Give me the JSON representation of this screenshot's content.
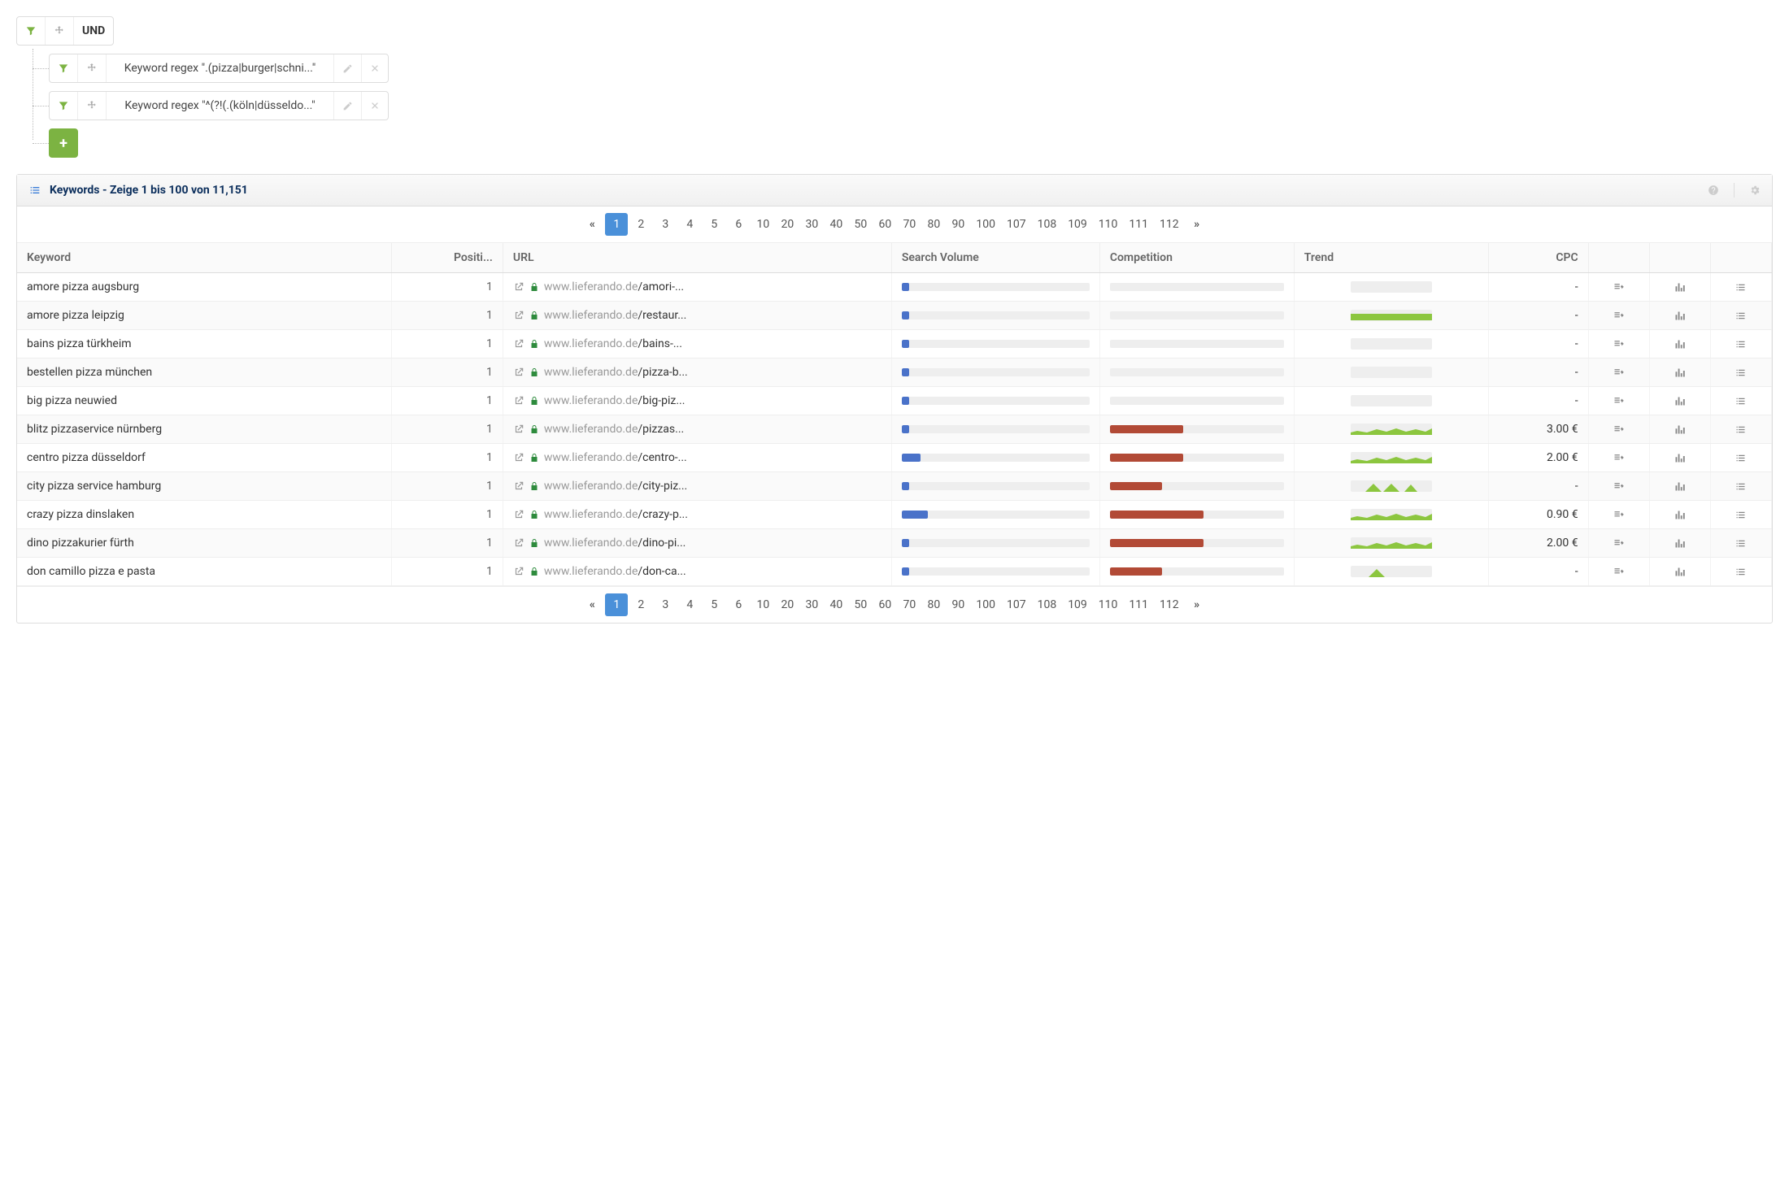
{
  "filter": {
    "operator": "UND",
    "rules": [
      {
        "label": "Keyword regex \".(pizza|burger|schni...\""
      },
      {
        "label": "Keyword regex \"^(?!(.(köln|düsseldo...\""
      }
    ]
  },
  "panel": {
    "title": "Keywords - Zeige 1 bis 100 von 11,151"
  },
  "pagination": {
    "pages": [
      "1",
      "2",
      "3",
      "4",
      "5",
      "6",
      "10",
      "20",
      "30",
      "40",
      "50",
      "60",
      "70",
      "80",
      "90",
      "100",
      "107",
      "108",
      "109",
      "110",
      "111",
      "112"
    ],
    "active": "1"
  },
  "columns": {
    "keyword": "Keyword",
    "position": "Positi...",
    "url": "URL",
    "volume": "Search Volume",
    "competition": "Competition",
    "trend": "Trend",
    "cpc": "CPC"
  },
  "url_domain": "www.lieferando.de",
  "rows": [
    {
      "keyword": "amore pizza augsburg",
      "position": "1",
      "path": "/amori-...",
      "volume_pct": 4,
      "competition_pct": 0,
      "trend": "empty",
      "cpc": "-"
    },
    {
      "keyword": "amore pizza leipzig",
      "position": "1",
      "path": "/restaur...",
      "volume_pct": 4,
      "competition_pct": 0,
      "trend": "flat",
      "cpc": "-"
    },
    {
      "keyword": "bains pizza türkheim",
      "position": "1",
      "path": "/bains-...",
      "volume_pct": 4,
      "competition_pct": 0,
      "trend": "empty",
      "cpc": "-"
    },
    {
      "keyword": "bestellen pizza münchen",
      "position": "1",
      "path": "/pizza-b...",
      "volume_pct": 4,
      "competition_pct": 0,
      "trend": "empty",
      "cpc": "-"
    },
    {
      "keyword": "big pizza neuwied",
      "position": "1",
      "path": "/big-piz...",
      "volume_pct": 4,
      "competition_pct": 0,
      "trend": "empty",
      "cpc": "-"
    },
    {
      "keyword": "blitz pizzaservice nürnberg",
      "position": "1",
      "path": "/pizzas...",
      "volume_pct": 4,
      "competition_pct": 42,
      "trend": "wave",
      "cpc": "3.00 €"
    },
    {
      "keyword": "centro pizza düsseldorf",
      "position": "1",
      "path": "/centro-...",
      "volume_pct": 10,
      "competition_pct": 42,
      "trend": "wave",
      "cpc": "2.00 €"
    },
    {
      "keyword": "city pizza service hamburg",
      "position": "1",
      "path": "/city-piz...",
      "volume_pct": 4,
      "competition_pct": 30,
      "trend": "peaks",
      "cpc": "-"
    },
    {
      "keyword": "crazy pizza dinslaken",
      "position": "1",
      "path": "/crazy-p...",
      "volume_pct": 14,
      "competition_pct": 54,
      "trend": "wave",
      "cpc": "0.90 €"
    },
    {
      "keyword": "dino pizzakurier fürth",
      "position": "1",
      "path": "/dino-pi...",
      "volume_pct": 4,
      "competition_pct": 54,
      "trend": "wave",
      "cpc": "2.00 €"
    },
    {
      "keyword": "don camillo pizza e pasta",
      "position": "1",
      "path": "/don-ca...",
      "volume_pct": 4,
      "competition_pct": 30,
      "trend": "bump",
      "cpc": "-"
    }
  ]
}
